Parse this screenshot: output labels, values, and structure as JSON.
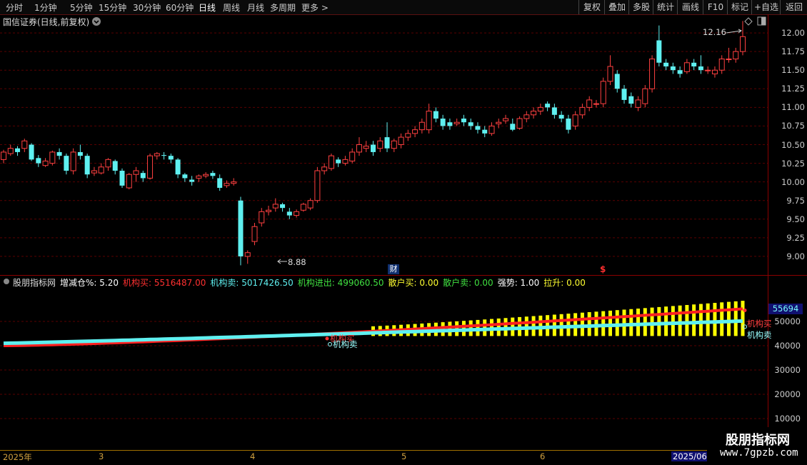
{
  "toolbar": {
    "timeframes": [
      "分时",
      "1分钟",
      "5分钟",
      "15分钟",
      "30分钟",
      "60分钟",
      "日线",
      "周线",
      "月线",
      "多周期",
      "更多 >"
    ],
    "active_timeframe": "日线",
    "right_tools": [
      "复权",
      "叠加",
      "多股",
      "统计",
      "画线",
      "F10",
      "标记",
      "+自选",
      "返回"
    ]
  },
  "main_pane": {
    "title": "国信证券(日线,前复权)",
    "dropdown_icon": "chevron-down-circle-icon",
    "high_label": "12.16",
    "low_label": "8.88",
    "marker_fin": "财",
    "marker_dollar": "$",
    "price_ticks": [
      "12.00",
      "11.75",
      "11.50",
      "11.25",
      "11.00",
      "10.75",
      "10.50",
      "10.25",
      "10.00",
      "9.75",
      "9.50",
      "9.25",
      "9.00"
    ]
  },
  "indicator_pane": {
    "name": "股朋指标网",
    "fields": [
      {
        "label": "增减仓%:",
        "value": "5.20",
        "color": "#ffffff"
      },
      {
        "label": "机构买:",
        "value": "5516487.00",
        "color": "#ff3030"
      },
      {
        "label": "机构卖:",
        "value": "5017426.50",
        "color": "#5ff0f0"
      },
      {
        "label": "机构进出:",
        "value": "499060.50",
        "color": "#40e040"
      },
      {
        "label": "散户买:",
        "value": "0.00",
        "color": "#ffff30"
      },
      {
        "label": "散户卖:",
        "value": "0.00",
        "color": "#40e040"
      },
      {
        "label": "强势:",
        "value": "1.00",
        "color": "#ffffff"
      },
      {
        "label": "拉升:",
        "value": "0.00",
        "color": "#ffff30"
      }
    ],
    "value_box": "55694",
    "ticks": [
      "50000",
      "40000",
      "30000",
      "20000",
      "10000"
    ],
    "legend_buy": "机构买",
    "legend_sell": "机构卖",
    "signal_buy": "机构买",
    "signal_sell": "机构卖"
  },
  "date_axis": {
    "labels": [
      "2025年",
      "3",
      "4",
      "5",
      "6",
      "2025/06"
    ]
  },
  "watermark": {
    "title": "股朋指标网",
    "url": "www.7gpzb.com"
  },
  "chart_data": {
    "type": "candlestick",
    "title": "国信证券(日线,前复权)",
    "y_range": [
      8.75,
      12.25
    ],
    "candles": [
      [
        10.3,
        10.4,
        10.25,
        10.43
      ],
      [
        10.38,
        10.45,
        10.35,
        10.5
      ],
      [
        10.45,
        10.4,
        10.35,
        10.48
      ],
      [
        10.45,
        10.55,
        10.4,
        10.58
      ],
      [
        10.5,
        10.3,
        10.28,
        10.52
      ],
      [
        10.32,
        10.25,
        10.2,
        10.36
      ],
      [
        10.22,
        10.28,
        10.2,
        10.32
      ],
      [
        10.25,
        10.4,
        10.22,
        10.42
      ],
      [
        10.4,
        10.35,
        10.3,
        10.45
      ],
      [
        10.35,
        10.15,
        10.1,
        10.38
      ],
      [
        10.15,
        10.4,
        10.1,
        10.45
      ],
      [
        10.4,
        10.35,
        10.3,
        10.5
      ],
      [
        10.35,
        10.1,
        10.05,
        10.38
      ],
      [
        10.12,
        10.15,
        10.08,
        10.2
      ],
      [
        10.12,
        10.2,
        10.1,
        10.25
      ],
      [
        10.2,
        10.3,
        10.15,
        10.32
      ],
      [
        10.28,
        10.15,
        10.1,
        10.3
      ],
      [
        10.15,
        9.95,
        9.92,
        10.18
      ],
      [
        9.92,
        10.1,
        9.9,
        10.12
      ],
      [
        10.1,
        10.15,
        10.0,
        10.2
      ],
      [
        10.12,
        10.05,
        10.0,
        10.15
      ],
      [
        10.05,
        10.35,
        10.03,
        10.38
      ],
      [
        10.35,
        10.38,
        10.3,
        10.4
      ],
      [
        10.36,
        10.35,
        10.3,
        10.4
      ],
      [
        10.35,
        10.3,
        10.25,
        10.38
      ],
      [
        10.3,
        10.1,
        10.05,
        10.32
      ],
      [
        10.1,
        10.05,
        10.0,
        10.12
      ],
      [
        10.03,
        10.0,
        9.95,
        10.08
      ],
      [
        10.05,
        10.08,
        10.0,
        10.1
      ],
      [
        10.08,
        10.1,
        10.05,
        10.13
      ],
      [
        10.12,
        10.08,
        10.04,
        10.15
      ],
      [
        10.05,
        9.92,
        9.88,
        10.1
      ],
      [
        9.95,
        9.98,
        9.92,
        10.02
      ],
      [
        9.98,
        10.0,
        9.95,
        10.05
      ],
      [
        9.75,
        9.0,
        8.88,
        9.8
      ],
      [
        9.0,
        9.05,
        8.9,
        9.08
      ],
      [
        9.2,
        9.4,
        9.15,
        9.45
      ],
      [
        9.45,
        9.6,
        9.4,
        9.65
      ],
      [
        9.6,
        9.62,
        9.55,
        9.68
      ],
      [
        9.65,
        9.7,
        9.6,
        9.78
      ],
      [
        9.7,
        9.65,
        9.6,
        9.72
      ],
      [
        9.6,
        9.55,
        9.5,
        9.65
      ],
      [
        9.55,
        9.6,
        9.52,
        9.63
      ],
      [
        9.62,
        9.7,
        9.6,
        9.72
      ],
      [
        9.65,
        9.75,
        9.62,
        9.78
      ],
      [
        9.75,
        10.15,
        9.72,
        10.2
      ],
      [
        10.15,
        10.2,
        10.1,
        10.25
      ],
      [
        10.18,
        10.35,
        10.15,
        10.38
      ],
      [
        10.3,
        10.25,
        10.2,
        10.33
      ],
      [
        10.25,
        10.3,
        10.22,
        10.35
      ],
      [
        10.28,
        10.4,
        10.25,
        10.45
      ],
      [
        10.4,
        10.5,
        10.35,
        10.6
      ],
      [
        10.45,
        10.48,
        10.4,
        10.55
      ],
      [
        10.5,
        10.4,
        10.35,
        10.55
      ],
      [
        10.45,
        10.55,
        10.4,
        10.6
      ],
      [
        10.6,
        10.45,
        10.4,
        10.8
      ],
      [
        10.45,
        10.55,
        10.4,
        10.58
      ],
      [
        10.5,
        10.6,
        10.45,
        10.65
      ],
      [
        10.6,
        10.65,
        10.55,
        10.7
      ],
      [
        10.65,
        10.7,
        10.6,
        10.75
      ],
      [
        10.7,
        10.8,
        10.65,
        10.85
      ],
      [
        10.7,
        10.95,
        10.65,
        11.05
      ],
      [
        10.95,
        10.85,
        10.8,
        11.0
      ],
      [
        10.85,
        10.75,
        10.7,
        10.9
      ],
      [
        10.8,
        10.75,
        10.7,
        10.85
      ],
      [
        10.78,
        10.8,
        10.75,
        10.85
      ],
      [
        10.85,
        10.8,
        10.75,
        10.9
      ],
      [
        10.8,
        10.75,
        10.7,
        10.85
      ],
      [
        10.75,
        10.7,
        10.65,
        10.8
      ],
      [
        10.7,
        10.65,
        10.6,
        10.75
      ],
      [
        10.65,
        10.75,
        10.62,
        10.8
      ],
      [
        10.78,
        10.8,
        10.72,
        10.85
      ],
      [
        10.82,
        10.85,
        10.78,
        10.9
      ],
      [
        10.78,
        10.7,
        10.68,
        10.85
      ],
      [
        10.72,
        10.85,
        10.7,
        10.88
      ],
      [
        10.85,
        10.9,
        10.8,
        10.95
      ],
      [
        10.9,
        10.95,
        10.85,
        11.0
      ],
      [
        10.95,
        11.0,
        10.9,
        11.05
      ],
      [
        11.05,
        11.0,
        10.95,
        11.08
      ],
      [
        11.0,
        10.9,
        10.85,
        11.05
      ],
      [
        10.9,
        10.85,
        10.8,
        10.95
      ],
      [
        10.85,
        10.7,
        10.65,
        10.9
      ],
      [
        10.75,
        10.9,
        10.7,
        10.95
      ],
      [
        10.9,
        11.0,
        10.85,
        11.05
      ],
      [
        11.0,
        11.1,
        10.95,
        11.15
      ],
      [
        11.05,
        11.05,
        11.0,
        11.1
      ],
      [
        11.05,
        11.35,
        11.0,
        11.4
      ],
      [
        11.35,
        11.55,
        11.3,
        11.7
      ],
      [
        11.45,
        11.25,
        11.2,
        11.5
      ],
      [
        11.25,
        11.1,
        11.05,
        11.3
      ],
      [
        11.15,
        11.05,
        11.0,
        11.2
      ],
      [
        11.0,
        11.1,
        10.95,
        11.15
      ],
      [
        11.05,
        11.25,
        11.0,
        11.3
      ],
      [
        11.25,
        11.65,
        11.2,
        11.7
      ],
      [
        11.9,
        11.6,
        11.55,
        12.1
      ],
      [
        11.6,
        11.55,
        11.5,
        11.65
      ],
      [
        11.55,
        11.5,
        11.45,
        11.6
      ],
      [
        11.5,
        11.45,
        11.4,
        11.55
      ],
      [
        11.48,
        11.6,
        11.45,
        11.65
      ],
      [
        11.6,
        11.55,
        11.5,
        11.65
      ],
      [
        11.55,
        11.5,
        11.45,
        11.7
      ],
      [
        11.5,
        11.5,
        11.45,
        11.55
      ],
      [
        11.45,
        11.5,
        11.4,
        11.55
      ],
      [
        11.5,
        11.65,
        11.45,
        11.7
      ],
      [
        11.65,
        11.65,
        11.6,
        11.8
      ],
      [
        11.65,
        11.75,
        11.6,
        11.8
      ],
      [
        11.75,
        11.95,
        11.7,
        12.16
      ]
    ],
    "high_value": 12.16,
    "low_value": 8.88,
    "indicator": {
      "y_range": [
        0,
        60000
      ],
      "series": [
        {
          "name": "机构买",
          "color": "#ff2020",
          "start": 40000,
          "end": 55165
        },
        {
          "name": "机构卖",
          "color": "#5ff0f0",
          "start": 41000,
          "end": 50174
        }
      ],
      "bar_series": {
        "color": "#ffff00",
        "first_index": 53,
        "start": 48000,
        "end": 58500
      }
    }
  }
}
